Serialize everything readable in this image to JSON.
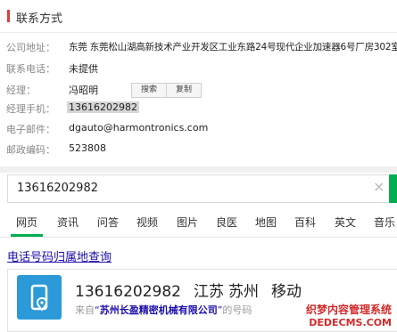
{
  "contact": {
    "section_title": "联系方式",
    "fields": [
      {
        "label": "公司地址：",
        "value": "东莞 东莞松山湖高新技术产业开发区工业东路24号现代企业加速器6号厂房302室"
      },
      {
        "label": "联系电话：",
        "value": "未提供"
      },
      {
        "label": "经理：",
        "value": "冯昭明"
      },
      {
        "label": "经理手机：",
        "value": "13616202982"
      },
      {
        "label": "电子邮件：",
        "value": "dgauto@harmontronics.com"
      },
      {
        "label": "邮政编码：",
        "value": "523808"
      }
    ],
    "search_button": "搜索",
    "copy_button": "复制"
  },
  "search": {
    "query": "13616202982",
    "clear_icon": "×",
    "accent": "#00b050"
  },
  "tabs": [
    "网页",
    "资讯",
    "问答",
    "视频",
    "图片",
    "良医",
    "地图",
    "百科",
    "英文",
    "音乐"
  ],
  "active_tab": "网页",
  "result": {
    "link_text": "电话号码归属地查询",
    "phone": "13616202982",
    "province": "江苏",
    "city": "苏州",
    "carrier": "移动",
    "from_prefix": "来自",
    "quote_open": "“",
    "company": "苏州长盈精密机械有限公司",
    "quote_close": "”",
    "suffix": "的号码",
    "icon": "phone-location-icon",
    "icon_color": "#2c9ad8"
  },
  "watermark": {
    "line1": "织梦内容管理系统",
    "line2": "DEDECMS.COM"
  }
}
